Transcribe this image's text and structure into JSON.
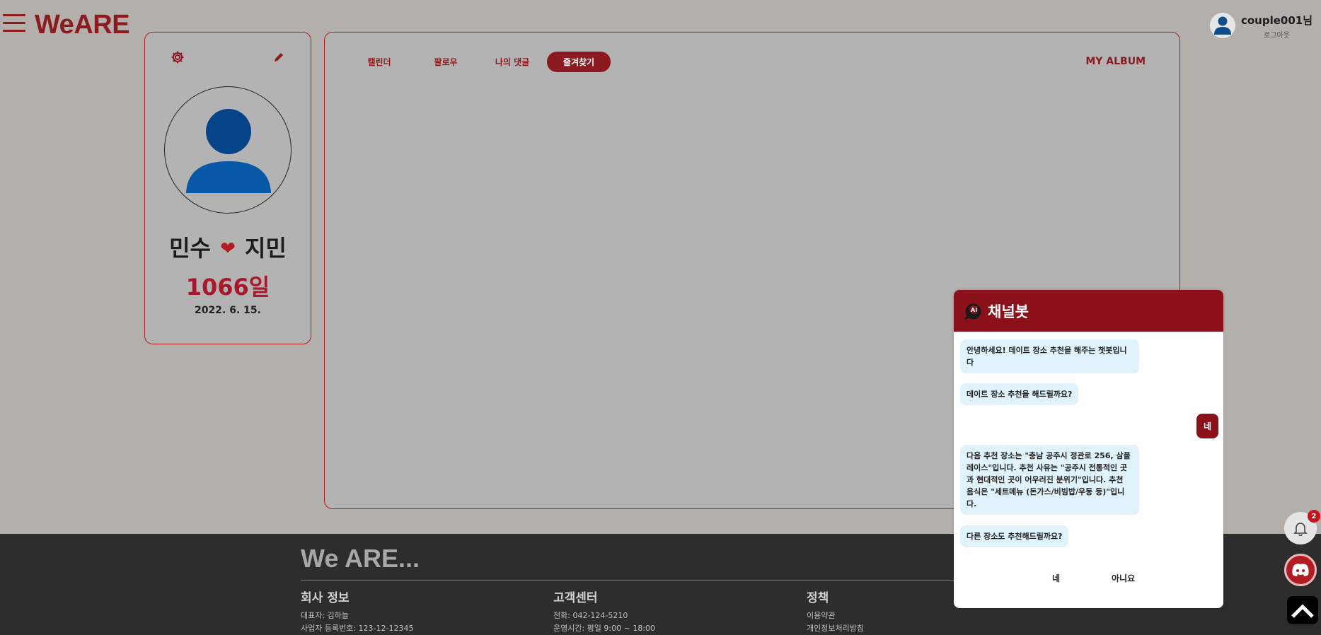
{
  "header": {
    "logo": "WeARE",
    "user_name": "couple001님",
    "logout": "로그아웃"
  },
  "profile": {
    "name1": "민수",
    "heart": "❤",
    "name2": "지민",
    "days": "1066일",
    "date": "2022. 6. 15."
  },
  "main": {
    "tabs": [
      {
        "label": "캘린더"
      },
      {
        "label": "팔로우"
      },
      {
        "label": "나의 댓글"
      },
      {
        "label": "즐겨찾기"
      }
    ],
    "active_tab": "즐겨찾기",
    "album_link": "MY ALBUM"
  },
  "footer": {
    "brand": "We ARE...",
    "company_title": "회사 정보",
    "company_lines": [
      "대표자: 김하늘",
      "사업자 등록번호: 123-12-12345"
    ],
    "support_title": "고객센터",
    "support_lines": [
      "전화: 042-124-5210",
      "운영시간: 평일 9:00 ~ 18:00"
    ],
    "policy_title": "정책",
    "policy_lines": [
      "이용약관",
      "개인정보처리방침"
    ]
  },
  "chatbot": {
    "title": "채널봇",
    "messages": [
      "안녕하세요! 데이트 장소 추천을 해주는 챗봇입니다",
      "데이트 장소 추천을 해드릴까요?",
      "네",
      "다음 추천 장소는 \"충남 공주시 정관로 256, 삼플레이스\"입니다. 추천 사유는 \"공주시 전통적인 곳과 현대적인 곳이 어우러진 분위기\"입니다. 추천 음식은 \"세트메뉴 (돈가스/비빔밥/우동 등)\"입니다.",
      "다른 장소도 추천해드릴까요?"
    ],
    "choice_yes": "네",
    "choice_no": "아니요"
  },
  "notifications": {
    "count": "2"
  },
  "colors": {
    "brand": "#8c1a1f",
    "accent_days": "#a8172a",
    "bubble_bg": "#e0f2fb",
    "background": "#b3b0ab",
    "footer_bg": "#2d2d2d"
  }
}
